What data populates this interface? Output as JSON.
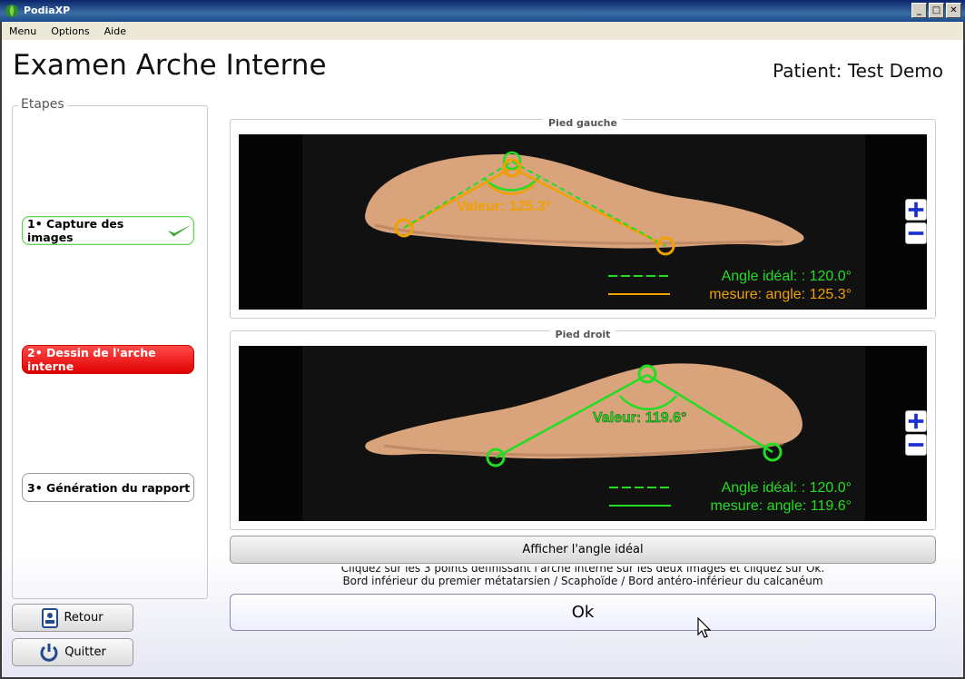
{
  "window": {
    "title": "PodiaXP"
  },
  "menu": {
    "items": [
      "Menu",
      "Options",
      "Aide"
    ]
  },
  "page": {
    "title": "Examen Arche Interne",
    "patient": "Patient: Test Demo"
  },
  "etapes": {
    "legend": "Etapes",
    "steps": [
      {
        "label": "1• Capture des images",
        "state": "done"
      },
      {
        "label": "2• Dessin de l'arche interne",
        "state": "active"
      },
      {
        "label": "3• Génération du rapport",
        "state": "pending"
      }
    ]
  },
  "buttons": {
    "retour": "Retour",
    "quitter": "Quitter",
    "afficher": "Afficher l'angle idéal",
    "ok": "Ok"
  },
  "panels": {
    "left": {
      "title": "Pied gauche",
      "value_label": "Valeur: 125.3°",
      "legend_ideal": "Angle idéal: : 120.0°",
      "legend_measure": "mesure: angle: 125.3°",
      "measure_color": "#f0a000",
      "ideal_color": "#22dd22"
    },
    "right": {
      "title": "Pied droit",
      "value_label": "Valeur: 119.6°",
      "legend_ideal": "Angle idéal: : 120.0°",
      "legend_measure": "mesure: angle: 119.6°",
      "measure_color": "#22dd22",
      "ideal_color": "#22dd22"
    }
  },
  "instructions": {
    "line1": "Cliquez sur les 3 points définissant l'arche interne sur les deux images et cliquez sur Ok.",
    "line2": "Bord inférieur du premier métatarsien / Scaphoïde / Bord antéro-inférieur du calcanéum"
  }
}
